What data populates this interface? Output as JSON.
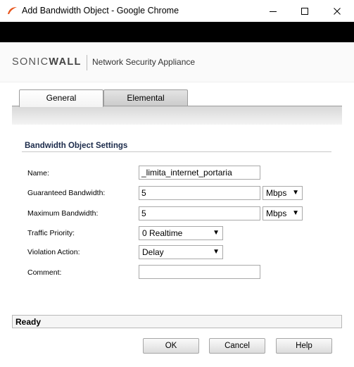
{
  "window": {
    "title": "Add Bandwidth Object - Google Chrome"
  },
  "header": {
    "brand_prefix": "SONIC",
    "brand_suffix": "WALL",
    "product": "Network Security Appliance"
  },
  "tabs": [
    {
      "label": "General",
      "active": true
    },
    {
      "label": "Elemental",
      "active": false
    }
  ],
  "section": {
    "title": "Bandwidth Object Settings"
  },
  "form": {
    "name": {
      "label": "Name:",
      "value": "_limita_internet_portaria"
    },
    "guaranteed": {
      "label": "Guaranteed Bandwidth:",
      "value": "5",
      "unit": "Mbps"
    },
    "maximum": {
      "label": "Maximum Bandwidth:",
      "value": "5",
      "unit": "Mbps"
    },
    "priority": {
      "label": "Traffic Priority:",
      "value": "0 Realtime"
    },
    "violation": {
      "label": "Violation Action:",
      "value": "Delay"
    },
    "comment": {
      "label": "Comment:",
      "value": ""
    }
  },
  "status": {
    "text": "Ready"
  },
  "buttons": {
    "ok": "OK",
    "cancel": "Cancel",
    "help": "Help"
  },
  "colors": {
    "url_bar": "#000000",
    "section_title": "#1b2a4a",
    "chrome_icon": "#e8551c"
  }
}
